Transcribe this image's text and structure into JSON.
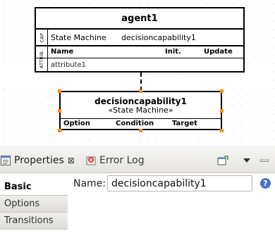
{
  "diagram": {
    "agent": {
      "title": "agent1",
      "cap_tag": "CAP.",
      "capability_type": "State Machine",
      "capability_name": "decisioncapability1",
      "attr_tag": "ATTRIB.",
      "attr_columns": [
        "Name",
        "Init.",
        "Update"
      ],
      "attributes": [
        "attribute1"
      ]
    },
    "capability": {
      "title": "decisioncapability1",
      "stereotype": "«State Machine»",
      "columns": [
        "Option",
        "Condition",
        "Target"
      ]
    }
  },
  "properties_view": {
    "tabs": [
      {
        "label": "Properties",
        "icon": "properties-icon",
        "close": "⊠"
      },
      {
        "label": "Error Log",
        "icon": "error-log-icon"
      }
    ],
    "side_tabs": [
      "Basic",
      "Options",
      "Transitions"
    ],
    "active_side_tab": "Basic",
    "name_label": "Name:",
    "name_value": "decisioncapability1",
    "help": "?"
  },
  "colors": {
    "selection_handle": "#f7941d",
    "help_button": "#4a72c4"
  }
}
